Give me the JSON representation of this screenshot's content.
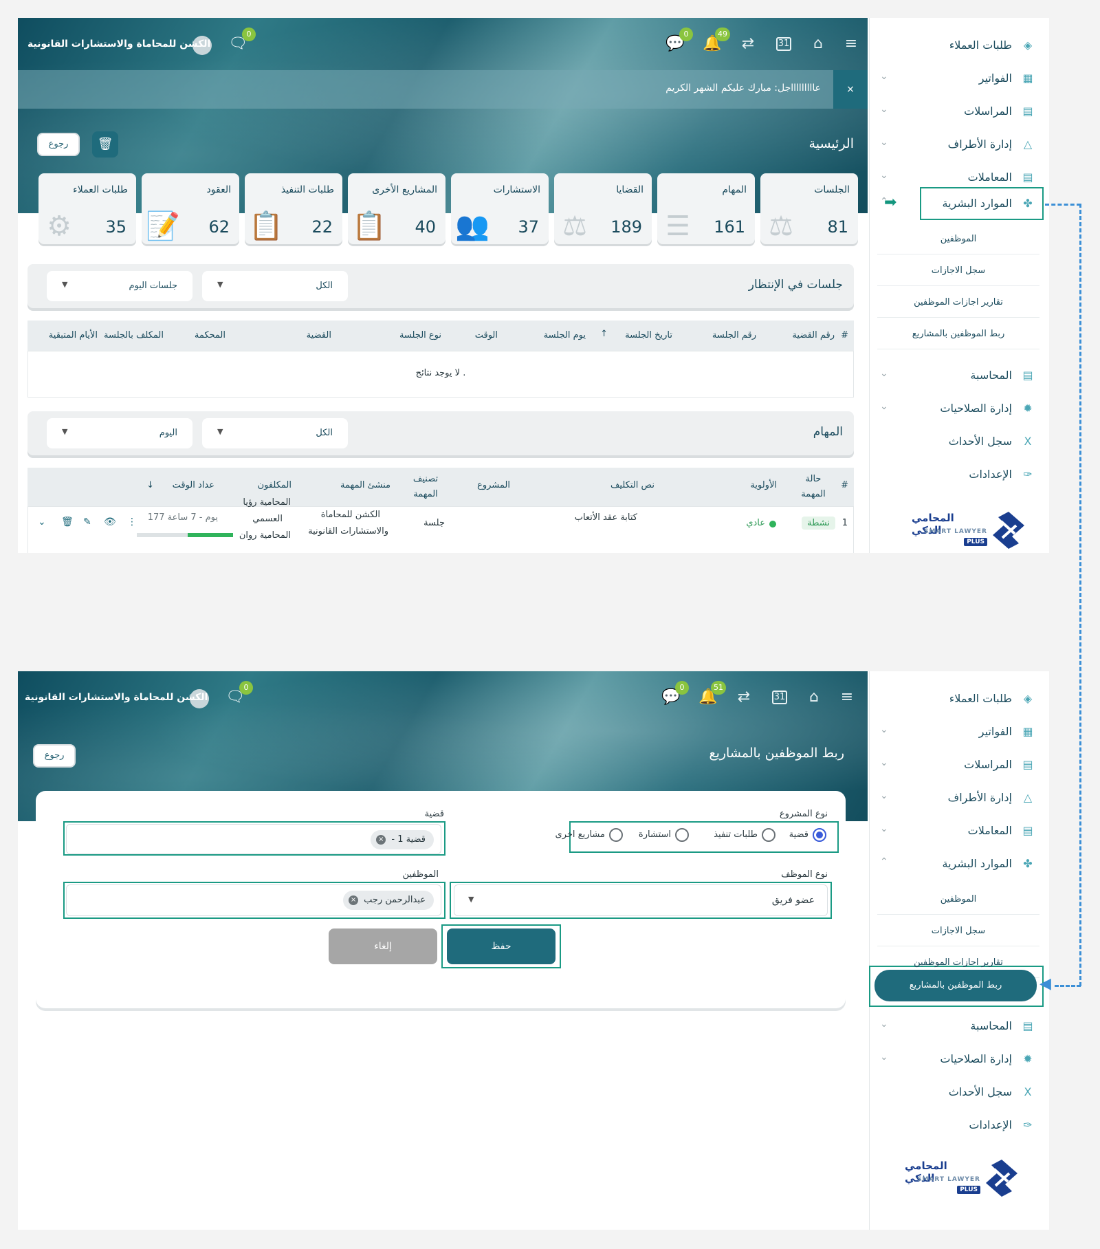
{
  "header": {
    "firm_name": "الكشن للمحاماة والاستشارات القانونية",
    "chat_badge": "0",
    "messages_badge": "0",
    "notifications_badge_1": "49",
    "notifications_badge_2": "51",
    "calendar_day": "31"
  },
  "announcement": {
    "text": "عاااااااااجل: مبارك عليكم الشهر الكريم",
    "close": "×"
  },
  "screen1": {
    "page_title": "الرئيسية",
    "back_label": "رجوع",
    "cards": [
      {
        "title": "الجلسات",
        "value": "81",
        "icon": "gavel-icon"
      },
      {
        "title": "المهام",
        "value": "161",
        "icon": "task-list-icon"
      },
      {
        "title": "القضايا",
        "value": "189",
        "icon": "scales-icon"
      },
      {
        "title": "الاستشارات",
        "value": "37",
        "icon": "consult-icon"
      },
      {
        "title": "المشاريع الأخرى",
        "value": "40",
        "icon": "project-icon"
      },
      {
        "title": "طلبات التنفيذ",
        "value": "22",
        "icon": "clipboard-icon"
      },
      {
        "title": "العقود",
        "value": "62",
        "icon": "contract-icon"
      },
      {
        "title": "طلبات العملاء",
        "value": "35",
        "icon": "clients-gear-icon"
      }
    ],
    "sessions": {
      "title": "جلسات في الإنتظار",
      "filter_all": "الكل",
      "filter_today": "جلسات اليوم",
      "columns": [
        "#",
        "رقم القضية",
        "رقم الجلسة",
        "تاريخ الجلسة",
        "يوم الجلسة",
        "الوقت",
        "نوع الجلسة",
        "القضية",
        "المحكمة",
        "المكلف بالجلسة",
        "الأيام المتبقية"
      ],
      "empty": "لا يوجد نتائج ."
    },
    "tasks": {
      "title": "المهام",
      "filter_all": "الكل",
      "filter_today": "اليوم",
      "columns": [
        "#",
        "حالة المهمة",
        "الأولوية",
        "نص التكليف",
        "المشروع",
        "تصنيف المهمة",
        "منشئ المهمة",
        "المكلفون",
        "عداد الوقت"
      ],
      "row": {
        "num": "1",
        "status": "نشطة",
        "priority": "عادي",
        "text": "كتابة عقد الأتعاب",
        "project": "",
        "category": "جلسة",
        "creator_1": "الكشن للمحاماة",
        "creator_2": "والاستشارات القانونية",
        "assignee_1": "المحامية رؤيا",
        "assignee_2": "العسمي",
        "assignee_3": "المحامية روان",
        "timer": "177 يوم - 7 ساعة"
      }
    }
  },
  "sidebar": {
    "items": [
      {
        "label": "طلبات العملاء",
        "icon": "layers-icon"
      },
      {
        "label": "الفواتير",
        "icon": "invoice-icon"
      },
      {
        "label": "المراسلات",
        "icon": "message-icon"
      },
      {
        "label": "إدارة الأطراف",
        "icon": "triangle-icon"
      },
      {
        "label": "المعاملات",
        "icon": "document-icon"
      },
      {
        "label": "الموارد البشرية",
        "icon": "people-icon"
      },
      {
        "label": "المحاسبة",
        "icon": "ledger-icon"
      },
      {
        "label": "إدارة الصلاحيات",
        "icon": "gear-icon"
      },
      {
        "label": "سجل الأحداث",
        "icon": "excel-icon"
      },
      {
        "label": "الإعدادات",
        "icon": "wrench-icon"
      }
    ],
    "hr_sub": [
      "الموظفين",
      "سجل الاجازات",
      "تقارير اجازات الموظفين",
      "ربط الموظفين بالمشاريع"
    ]
  },
  "logo": {
    "ar": "المحامي الذكي",
    "en": "SMART LAWYER",
    "plus": "PLUS"
  },
  "screen2": {
    "page_title": "ربط الموظفين بالمشاريع",
    "back_label": "رجوع",
    "project_type_label": "نوع المشروع",
    "project_types": [
      "قضية",
      "طلبات تنفيذ",
      "استشارة",
      "مشاريع اخرى"
    ],
    "selected_type": "قضية",
    "case_label": "قضية",
    "case_chip": "- قضية 1",
    "employee_type_label": "نوع الموظف",
    "employee_type_value": "عضو فريق",
    "employees_label": "الموظفين",
    "employee_chip": "عبدالرحمن رجب",
    "save": "حفظ",
    "cancel": "إلغاء"
  },
  "colors": {
    "accent": "#1f6b7c",
    "highlight": "#1a9a84",
    "dashed_arrow": "#3b8fd6",
    "badge": "#8ac43f"
  }
}
